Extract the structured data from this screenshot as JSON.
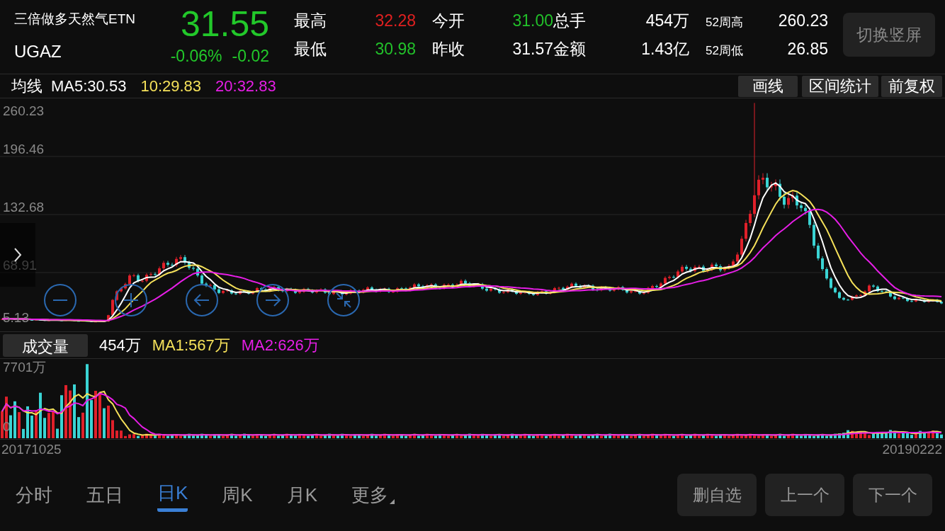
{
  "header": {
    "name": "三倍做多天然气ETN",
    "symbol": "UGAZ",
    "price": "31.55",
    "change_pct": "-0.06%",
    "change": "-0.02",
    "color": "#22c82a"
  },
  "stats": [
    {
      "label": "最高",
      "value": "32.28",
      "color": "#e02020"
    },
    {
      "label": "今开",
      "value": "31.00",
      "color": "#22c02a"
    },
    {
      "label": "总手",
      "value": "454万",
      "color": "#ffffff"
    },
    {
      "label": "52周高",
      "value": "260.23",
      "color": "#ffffff"
    },
    {
      "label": "最低",
      "value": "30.98",
      "color": "#22c02a"
    },
    {
      "label": "昨收",
      "value": "31.57",
      "color": "#ffffff"
    },
    {
      "label": "金额",
      "value": "1.43亿",
      "color": "#ffffff"
    },
    {
      "label": "52周低",
      "value": "26.85",
      "color": "#ffffff"
    }
  ],
  "switch_button": "切换竖屏",
  "ma_bar": {
    "label": "均线",
    "items": [
      {
        "text": "MA5:30.53",
        "color": "#ffffff"
      },
      {
        "text": "10:29.83",
        "color": "#f5e15a"
      },
      {
        "text": "20:32.83",
        "color": "#e61ee6"
      }
    ]
  },
  "tools": [
    "画线",
    "区间统计",
    "前复权"
  ],
  "price_axis": [
    "260.23",
    "196.46",
    "132.68",
    "68.91",
    "5.13"
  ],
  "volume_bar": {
    "label": "成交量",
    "value": "454万",
    "items": [
      {
        "text": "MA1:567万",
        "color": "#f5e15a"
      },
      {
        "text": "MA2:626万",
        "color": "#e61ee6"
      }
    ]
  },
  "volume_axis": [
    "7701万",
    "0"
  ],
  "dates": [
    "20171025",
    "20190222"
  ],
  "period_tabs": [
    {
      "label": "分时",
      "selected": false,
      "kind": "tab"
    },
    {
      "label": "五日",
      "selected": false,
      "kind": "tab"
    },
    {
      "label": "日K",
      "selected": true,
      "kind": "tab"
    },
    {
      "label": "周K",
      "selected": false,
      "kind": "tab"
    },
    {
      "label": "月K",
      "selected": false,
      "kind": "tab"
    },
    {
      "label": "更多",
      "selected": false,
      "kind": "menu"
    }
  ],
  "actions": [
    "删自选",
    "上一个",
    "下一个"
  ]
}
